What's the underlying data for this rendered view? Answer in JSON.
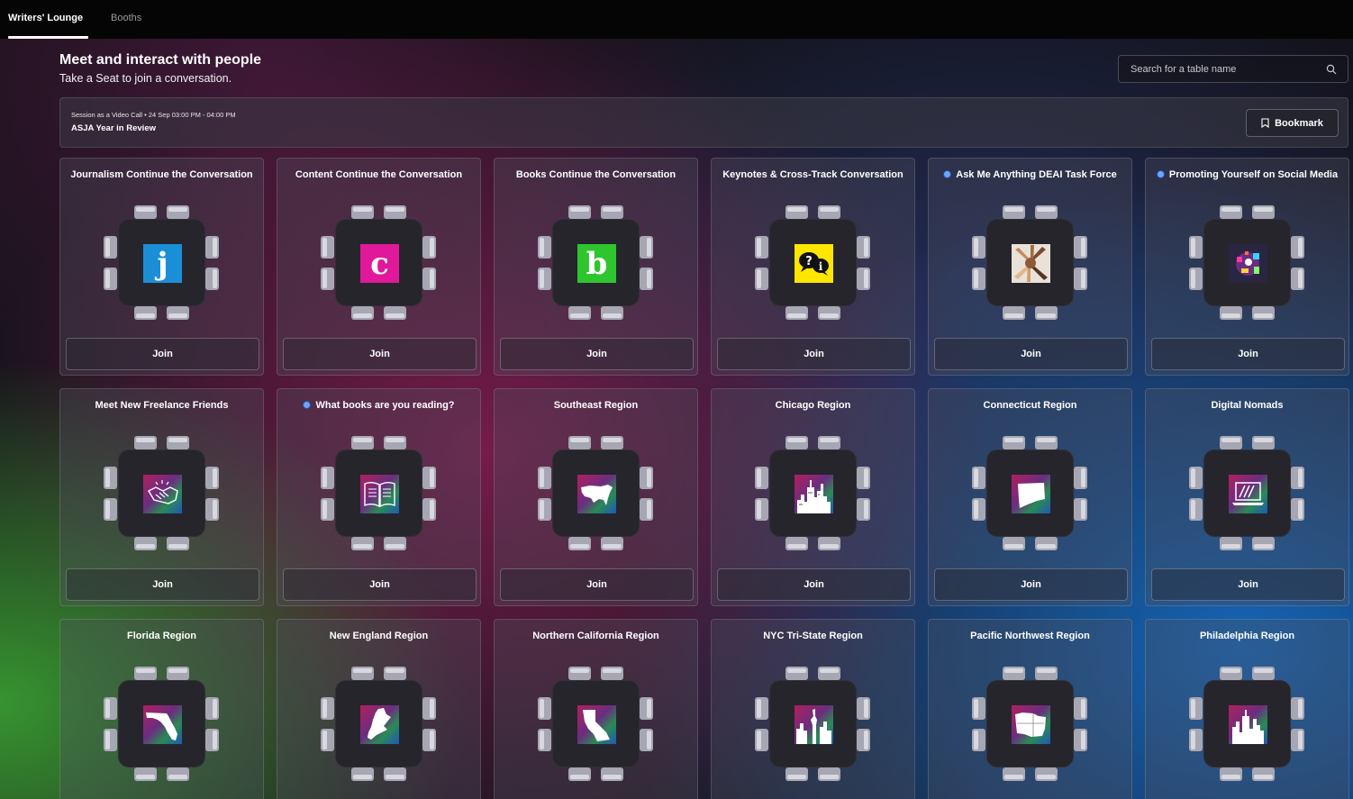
{
  "tabs": [
    {
      "label": "Writers' Lounge",
      "active": true
    },
    {
      "label": "Booths",
      "active": false
    }
  ],
  "header": {
    "title": "Meet and interact with people",
    "subtitle": "Take a Seat to join a conversation."
  },
  "search": {
    "placeholder": "Search for a table name"
  },
  "session": {
    "meta": "Session as a Video Call  • 24 Sep 03:00 PM - 04:00 PM",
    "name": "ASJA Year in Review",
    "bookmark_label": "Bookmark"
  },
  "join_label": "Join",
  "tables": [
    {
      "title": "Journalism Continue the Conversation",
      "icon": "letter-j-icon",
      "has_dot": false
    },
    {
      "title": "Content Continue the Conversation",
      "icon": "letter-c-icon",
      "has_dot": false
    },
    {
      "title": "Books Continue the Conversation",
      "icon": "letter-b-icon",
      "has_dot": false
    },
    {
      "title": "Keynotes & Cross-Track Conversation",
      "icon": "question-info-bubbles-icon",
      "has_dot": false
    },
    {
      "title": "Ask Me Anything DEAI Task Force",
      "icon": "stacked-hands-icon",
      "has_dot": true
    },
    {
      "title": "Promoting Yourself on Social Media",
      "icon": "social-media-icon",
      "has_dot": true
    },
    {
      "title": "Meet New Freelance Friends",
      "icon": "handshake-icon",
      "has_dot": false
    },
    {
      "title": "What books are you reading?",
      "icon": "open-book-icon",
      "has_dot": true
    },
    {
      "title": "Southeast Region",
      "icon": "usa-map-icon",
      "has_dot": false
    },
    {
      "title": "Chicago Region",
      "icon": "city-skyline-icon",
      "has_dot": false
    },
    {
      "title": "Connecticut Region",
      "icon": "connecticut-map-icon",
      "has_dot": false
    },
    {
      "title": "Digital Nomads",
      "icon": "laptop-icon",
      "has_dot": false
    },
    {
      "title": "Florida Region",
      "icon": "florida-map-icon",
      "has_dot": false
    },
    {
      "title": "New England Region",
      "icon": "new-england-map-icon",
      "has_dot": false
    },
    {
      "title": "Northern California Region",
      "icon": "california-map-icon",
      "has_dot": false
    },
    {
      "title": "NYC Tri-State Region",
      "icon": "statue-of-liberty-icon",
      "has_dot": false
    },
    {
      "title": "Pacific Northwest Region",
      "icon": "pacific-northwest-map-icon",
      "has_dot": false
    },
    {
      "title": "Philadelphia Region",
      "icon": "philadelphia-skyline-icon",
      "has_dot": false
    }
  ],
  "colors": {
    "j": "#1a8fd8",
    "c": "#e0199a",
    "b": "#2ec52e",
    "keynote": "#ffe600"
  }
}
